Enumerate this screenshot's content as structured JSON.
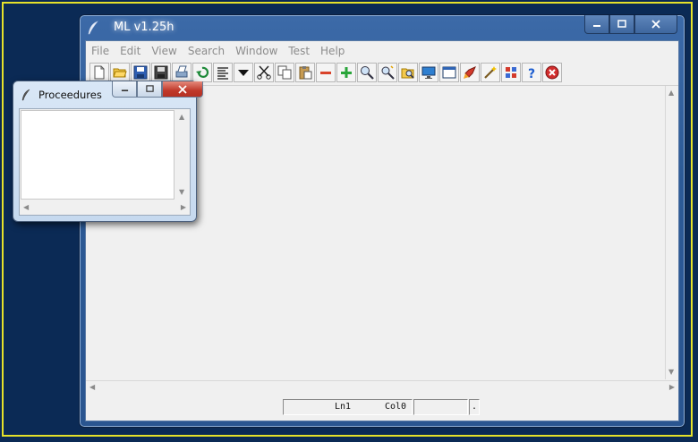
{
  "main_window": {
    "title": "ML v1.25h",
    "controls": {
      "minimize": "—",
      "maximize": "☐",
      "close": "✕"
    }
  },
  "menu": {
    "items": [
      "File",
      "Edit",
      "View",
      "Search",
      "Window",
      "Test",
      "Help"
    ]
  },
  "toolbar": {
    "icons": [
      "new-file-icon",
      "open-folder-icon",
      "save-icon",
      "save-all-icon",
      "print-icon",
      "undo-icon",
      "format-icon",
      "dropdown-icon",
      "cut-icon",
      "copy-icon",
      "paste-icon",
      "minus-icon",
      "plus-icon",
      "zoom-icon",
      "find-icon",
      "search-folder-icon",
      "monitor-icon",
      "window-icon",
      "run-icon",
      "wand-icon",
      "grid-icon",
      "help-icon",
      "stop-icon"
    ]
  },
  "status": {
    "line": "Ln1",
    "col": "Col0",
    "extra": "",
    "tail": "."
  },
  "procedures_window": {
    "title": "Proceedures",
    "controls": {
      "minimize": "—",
      "maximize": "☐",
      "close": "✕"
    }
  },
  "colors": {
    "desktop": "#0b2a55",
    "frame_border": "#e6e22a",
    "title_bar": "#2c5a96",
    "client": "#f0f0f0",
    "menu_text": "#8c8c8c"
  }
}
